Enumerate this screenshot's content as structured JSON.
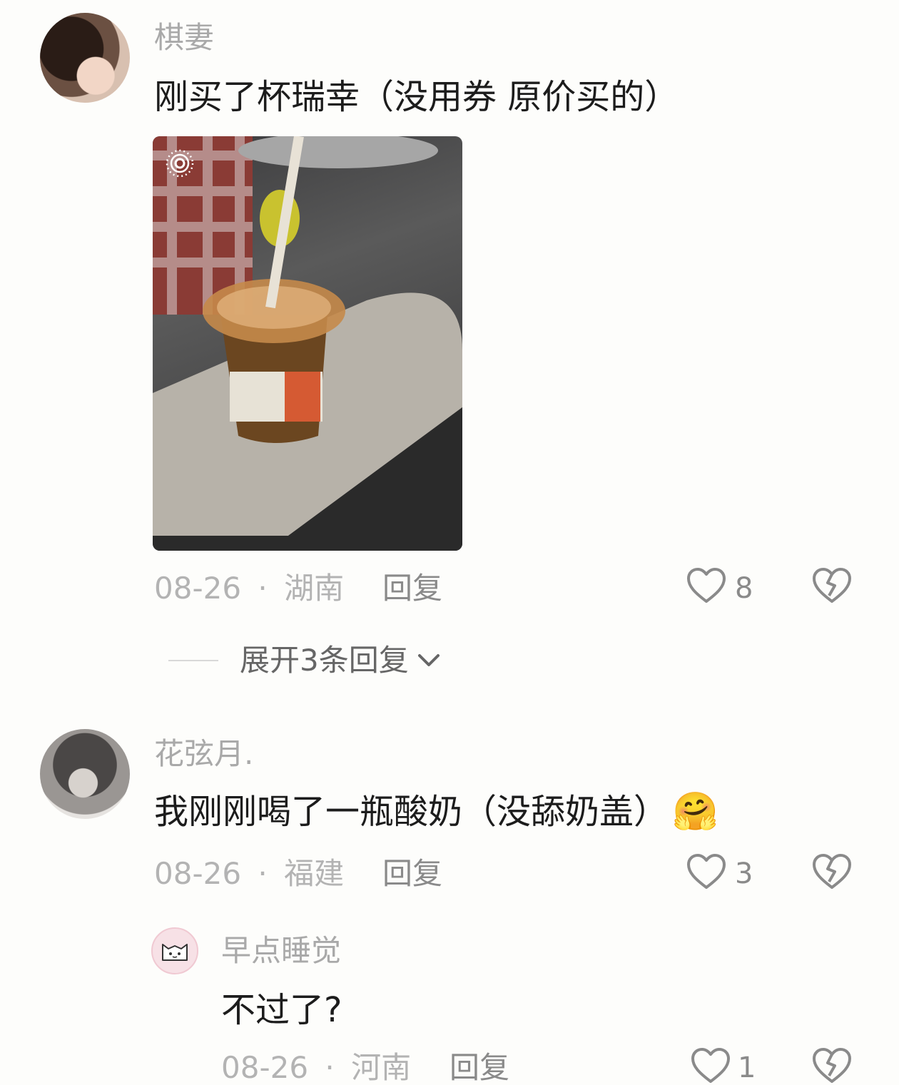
{
  "comments": [
    {
      "username": "棋妻",
      "text": "刚买了杯瑞幸（没用券 原价买的）",
      "date": "08-26",
      "region": "湖南",
      "reply_label": "回复",
      "likes": "8",
      "expand_label": "展开3条回复",
      "photo_badge": "live-photo-icon"
    },
    {
      "username": "花弦月.",
      "text": "我刚刚喝了一瓶酸奶（没舔奶盖）",
      "emoji": "🤗",
      "date": "08-26",
      "region": "福建",
      "reply_label": "回复",
      "likes": "3",
      "replies": [
        {
          "username": "早点睡觉",
          "text": "不过了?",
          "date": "08-26",
          "region": "河南",
          "reply_label": "回复",
          "likes": "1"
        }
      ]
    }
  ],
  "separator": "·",
  "icons": {
    "like": "heart-outline-icon",
    "dislike": "broken-heart-icon",
    "expand": "chevron-down-icon"
  }
}
